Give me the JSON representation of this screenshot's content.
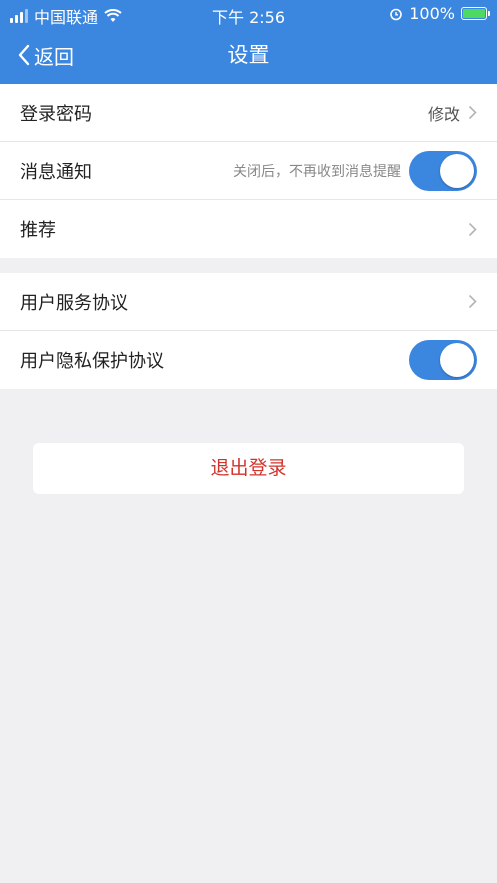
{
  "status_bar": {
    "carrier": "中国联通",
    "time": "下午 2:56",
    "battery": "100%",
    "icons": [
      "signal-icon",
      "wifi-icon",
      "alarm-icon",
      "battery-icon"
    ]
  },
  "header": {
    "back_label": "返回",
    "title": "设置",
    "background_color": "#3b86df"
  },
  "settings_group_1": [
    {
      "label": "登录密码",
      "action": "修改",
      "type": "link"
    },
    {
      "label": "消息通知",
      "hint": "关闭后，不再收到消息提醒",
      "type": "toggle",
      "enabled": true
    },
    {
      "label": "推荐",
      "type": "link"
    }
  ],
  "settings_group_2": [
    {
      "label": "用户服务协议",
      "type": "link"
    },
    {
      "label": "用户隐私保护协议",
      "type": "toggle",
      "enabled": true
    }
  ],
  "logout_button": {
    "label": "退出登录",
    "color": "#d0342c"
  },
  "toggle_on_color": "#3b86df"
}
